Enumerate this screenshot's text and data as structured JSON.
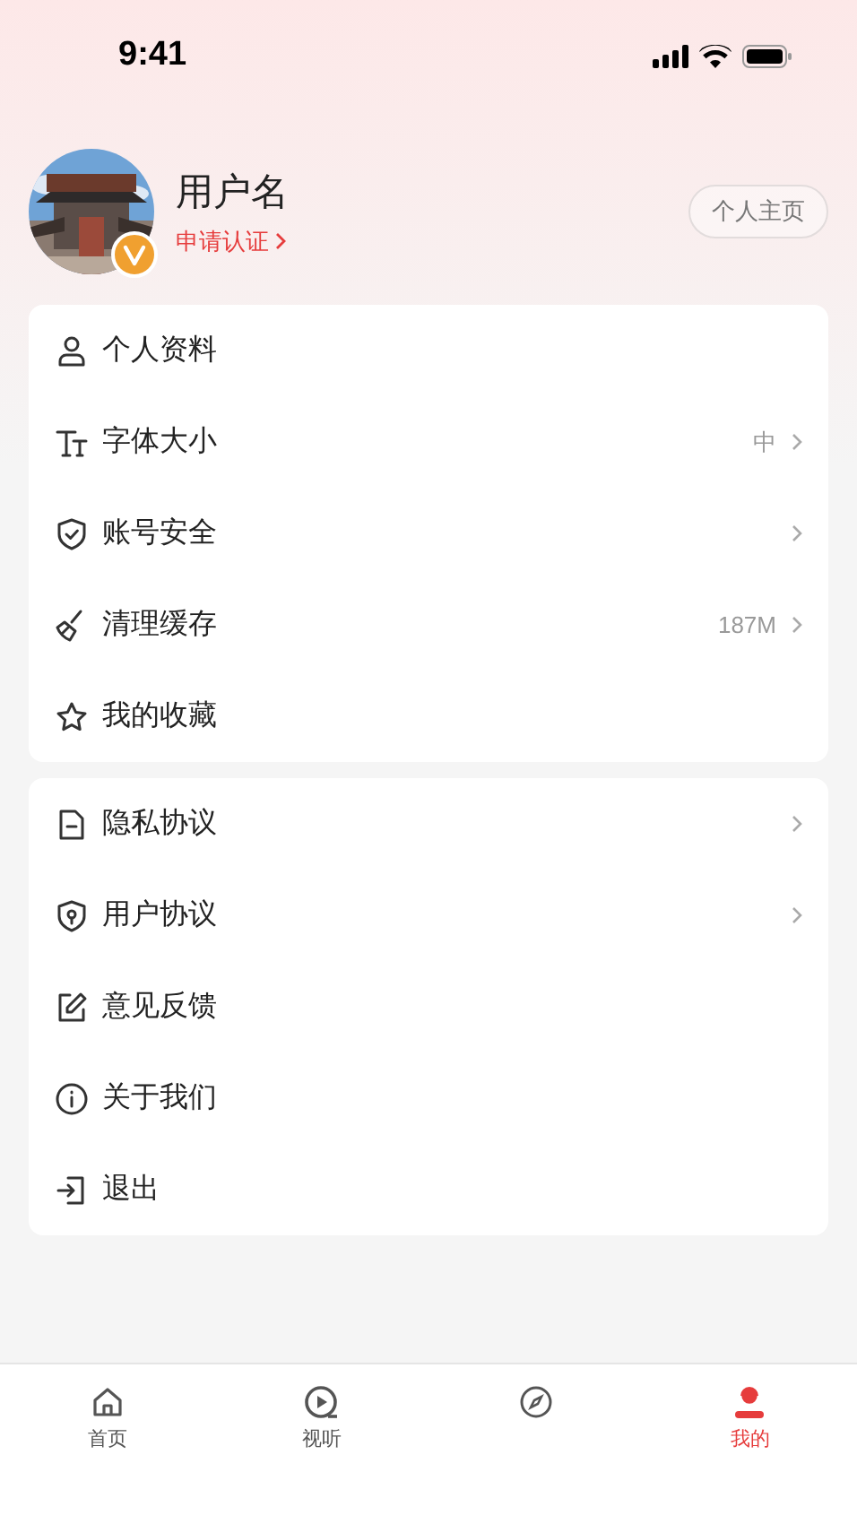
{
  "status_bar": {
    "time": "9:41"
  },
  "profile": {
    "username": "用户名",
    "verify_link": "申请认证",
    "homepage_button": "个人主页"
  },
  "groups": [
    {
      "items": [
        {
          "label": "个人资料",
          "value": null,
          "arrow": false
        },
        {
          "label": "字体大小",
          "value": "中",
          "arrow": true
        },
        {
          "label": "账号安全",
          "value": null,
          "arrow": true
        },
        {
          "label": "清理缓存",
          "value": "187M",
          "arrow": true
        },
        {
          "label": "我的收藏",
          "value": null,
          "arrow": false
        }
      ]
    },
    {
      "items": [
        {
          "label": "隐私协议",
          "value": null,
          "arrow": true
        },
        {
          "label": "用户协议",
          "value": null,
          "arrow": true
        },
        {
          "label": "意见反馈",
          "value": null,
          "arrow": false
        },
        {
          "label": "关于我们",
          "value": null,
          "arrow": false
        },
        {
          "label": "退出",
          "value": null,
          "arrow": false
        }
      ]
    }
  ],
  "tab_bar": [
    {
      "label": "首页",
      "selected": false
    },
    {
      "label": "视听",
      "selected": false
    },
    {
      "selected": false
    },
    {
      "label": "我的",
      "selected": true
    }
  ]
}
